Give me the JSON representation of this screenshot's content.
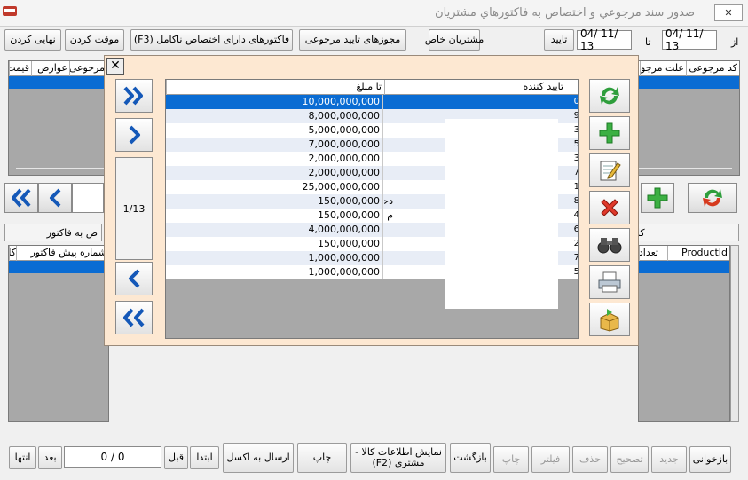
{
  "window": {
    "title": "صدور سند مرجوعي و اختصاص به فاکتورهاي مشتريان",
    "close_icon": "x-icon"
  },
  "filter": {
    "from_label": "از",
    "to_label": "تا",
    "from_date": "04/ 11/ 13",
    "to_date": "04/ 11/ 13",
    "approve_label": "تایید"
  },
  "toolbar": {
    "special_customers": "مشتریان خاص",
    "return_approval_permits": "مجوزهای تایید مرجوعی",
    "incomplete_allocation_invoices": "فاکتورهای دارای اختصاص ناکامل (F3)",
    "temporary_record": "موقت کردن",
    "finalize": "نهایی کردن"
  },
  "top_grid": {
    "columns": [
      "کد مرجوعی",
      "علت مرجوعی",
      "مرجوعی",
      "عوارض",
      "قیمت"
    ]
  },
  "lower_panel": {
    "tab_left": "ص به فاکتور",
    "tab_right": "کا",
    "left_columns": [
      "شماره پیش فاکتور",
      "کار"
    ],
    "right_columns": [
      "ProductId",
      "تعداد"
    ]
  },
  "dialog": {
    "page_indicator": "1/13",
    "columns": {
      "amount": "تا مبلغ",
      "approver": "تایید کننده"
    },
    "rows": [
      {
        "amount": "10,000,000,000",
        "approver": "",
        "id": "0"
      },
      {
        "amount": "8,000,000,000",
        "approver": "",
        "id": "9"
      },
      {
        "amount": "5,000,000,000",
        "approver": "",
        "id": "3"
      },
      {
        "amount": "7,000,000,000",
        "approver": "",
        "id": "5"
      },
      {
        "amount": "2,000,000,000",
        "approver": "",
        "id": "3"
      },
      {
        "amount": "2,000,000,000",
        "approver": "",
        "id": "7"
      },
      {
        "amount": "25,000,000,000",
        "approver": "",
        "id": "1"
      },
      {
        "amount": "150,000,000",
        "approver": "دحسین",
        "id": "8"
      },
      {
        "amount": "150,000,000",
        "approver": "م",
        "id": "4"
      },
      {
        "amount": "4,000,000,000",
        "approver": "",
        "id": "6"
      },
      {
        "amount": "150,000,000",
        "approver": "",
        "id": "2"
      },
      {
        "amount": "1,000,000,000",
        "approver": "",
        "id": "7"
      },
      {
        "amount": "1,000,000,000",
        "approver": "",
        "id": "5"
      }
    ]
  },
  "bottom_bar": {
    "reload": "بازخوانی",
    "new": "جدید",
    "edit": "تصحیح",
    "delete": "حذف",
    "filter": "فیلتر",
    "print_disabled": "چاپ",
    "back": "بازگشت",
    "show_goods_info": "نمایش اطلاعات کالا - مشتری (F2)",
    "print": "چاپ",
    "send_to_excel": "ارسال به اکسل",
    "first": "ابتدا",
    "prev": "قبل",
    "record_counter": "0 / 0",
    "next": "بعد",
    "last": "انتها"
  },
  "colors": {
    "selection": "#0a6cd3",
    "dialog_bg": "#fde8d2",
    "grid_bg": "#a8a8a8"
  }
}
